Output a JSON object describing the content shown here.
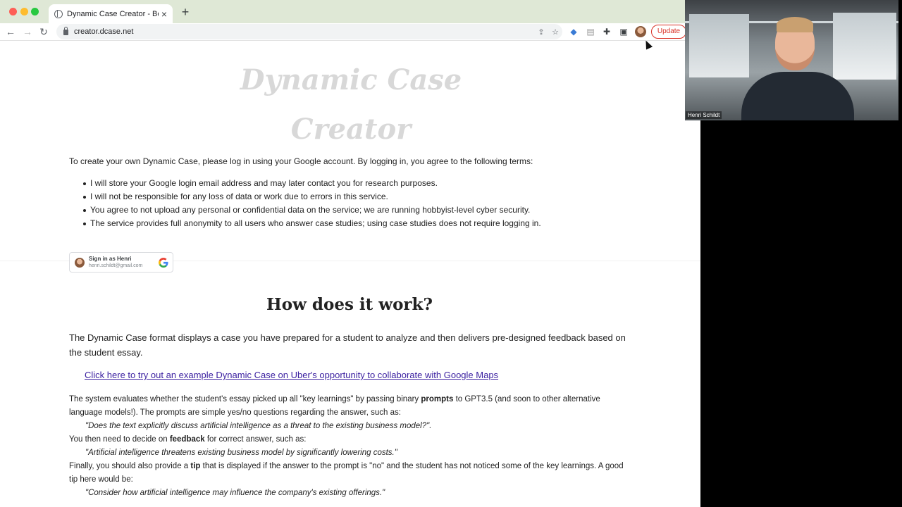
{
  "browser": {
    "tab_title": "Dynamic Case Creator - Beta",
    "url": "creator.dcase.net",
    "update_label": "Update"
  },
  "page": {
    "logo_line1": "Dynamic Case",
    "logo_line2": "Creator",
    "intro": "To create your own Dynamic Case, please log in using your Google account. By logging in, you agree to the following terms:",
    "terms": [
      "I will store your Google login email address and may later contact you for research purposes.",
      "I will not be responsible for any loss of data or work due to errors in this service.",
      "You agree to not upload any personal or confidential data on the service; we are running hobbyist-level cyber security.",
      "The service provides full anonymity to all users who answer case studies; using case studies does not require logging in."
    ],
    "signin": {
      "name": "Sign in as Henri",
      "email": "henri.schildt@gmail.com"
    },
    "how_heading": "How does it work?",
    "para1": "The Dynamic Case format displays a case you have prepared for a student to analyze and then delivers pre-designed feedback based on the student essay.",
    "example_link": "Click here to try out an example Dynamic Case on Uber's opportunity to collaborate with Google Maps",
    "para2": {
      "s1_a": "The system evaluates whether the student's essay picked up all \"key learnings\" by passing binary ",
      "s1_bold": "prompts",
      "s1_b": " to GPT3.5 (and soon to other alternative language models!). The prompts are simple yes/no questions regarding the answer, such as:",
      "q1": "\"Does the text explicitly discuss artificial intelligence as a threat to the existing business model?\".",
      "s2_a": "You then need to decide on ",
      "s2_bold": "feedback",
      "s2_b": " for correct answer, such as:",
      "q2": "\"Artificial intelligence threatens existing business model by significantly lowering costs.\"",
      "s3_a": "Finally, you should also provide a ",
      "s3_bold": "tip",
      "s3_b": " that is displayed if the answer to the prompt is \"no\" and the student has not noticed some of the key learnings. A good tip here would be:",
      "q3": "\"Consider how artificial intelligence may influence the company's existing offerings.\""
    }
  },
  "video": {
    "participant_name": "Henri Schildt"
  }
}
